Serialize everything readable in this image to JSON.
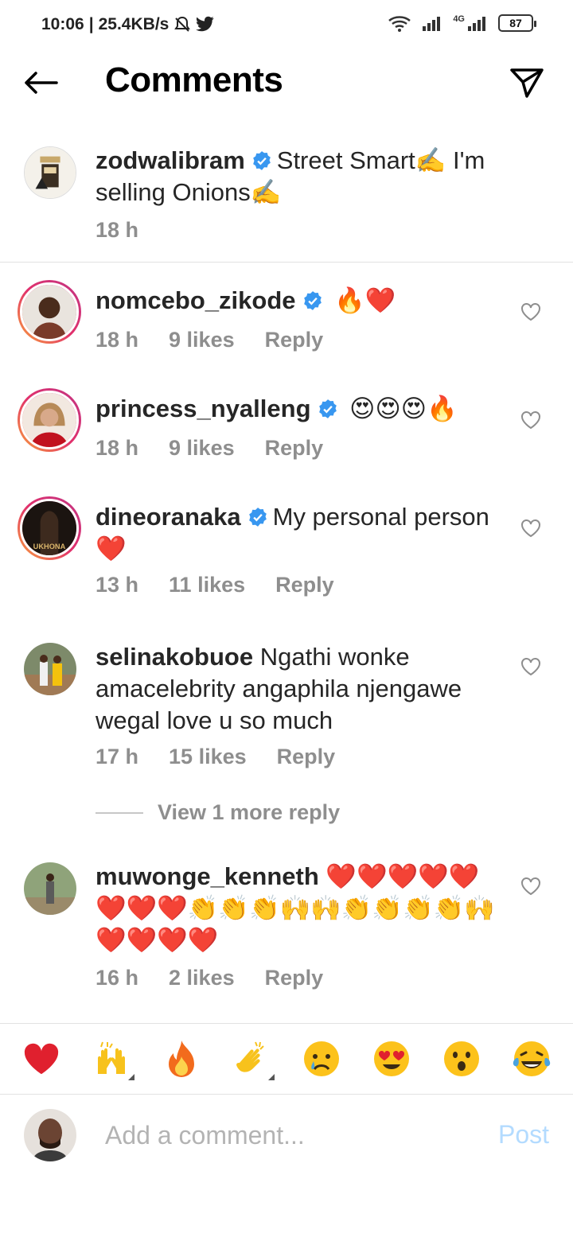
{
  "status_bar": {
    "time": "10:06",
    "speed": "25.4KB/s",
    "network_type": "4G",
    "battery": "87"
  },
  "header": {
    "title": "Comments",
    "back_icon": "back-arrow-icon",
    "share_icon": "paper-plane-icon"
  },
  "caption": {
    "username": "zodwalibram",
    "text": "Street Smart✍️ I'm selling Onions✍️",
    "time": "18 h"
  },
  "comments": [
    {
      "username": "nomcebo_zikode",
      "verified": true,
      "text": "🔥❤️",
      "time": "18 h",
      "likes": "9 likes",
      "reply": "Reply"
    },
    {
      "username": "princess_nyalleng",
      "verified": true,
      "text": "😍😍😍🔥",
      "time": "18 h",
      "likes": "9 likes",
      "reply": "Reply"
    },
    {
      "username": "dineoranaka",
      "verified": true,
      "text": "My personal person ❤️",
      "time": "13 h",
      "likes": "11 likes",
      "reply": "Reply"
    },
    {
      "username": "selinakobuoe",
      "verified": false,
      "text": "Ngathi wonke amacelebrity angaphila njengawe wegal love u so much",
      "time": "17 h",
      "likes": "15 likes",
      "reply": "Reply"
    },
    {
      "username": "muwonge_kenneth",
      "verified": false,
      "text": "❤️❤️❤️❤️❤️❤️❤️❤️👏👏👏🙌🙌👏👏👏👏🙌❤️❤️❤️❤️",
      "time": "16 h",
      "likes": "2 likes",
      "reply": "Reply"
    }
  ],
  "view_more": "View 1 more reply",
  "emoji_bar": [
    "❤️",
    "🙌",
    "🔥",
    "👏",
    "😢",
    "😍",
    "😮",
    "😂"
  ],
  "add_comment": {
    "placeholder": "Add a comment...",
    "post_label": "Post"
  },
  "colors": {
    "verified": "#3897f0",
    "muted": "#8e8e8e",
    "post_disabled": "#b3dbff"
  }
}
